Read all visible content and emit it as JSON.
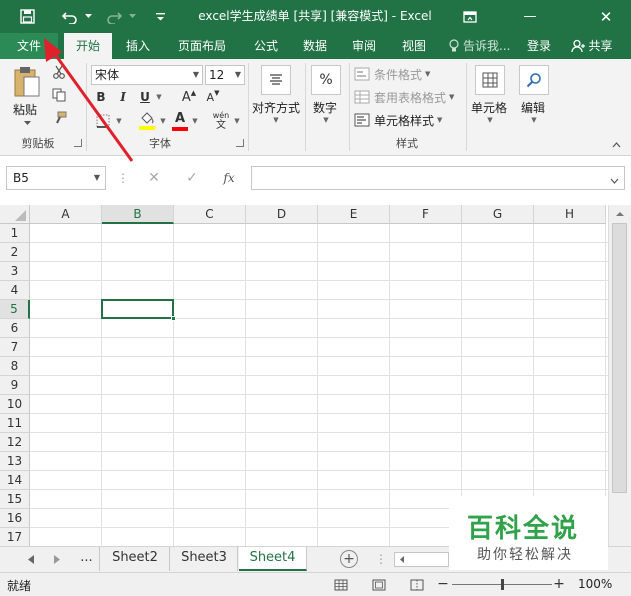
{
  "window": {
    "title": "excel学生成绩单  [共享]  [兼容模式] - Excel",
    "restore_icon": "ribbon-display-icon",
    "minimize_glyph": "—",
    "close_glyph": "✕"
  },
  "tabs": {
    "file": "文件",
    "items": [
      "开始",
      "插入",
      "页面布局",
      "公式",
      "数据",
      "审阅",
      "视图"
    ],
    "active": "开始",
    "tell_me": "告诉我...",
    "login": "登录",
    "share": "共享"
  },
  "ribbon": {
    "clipboard": {
      "paste": "粘贴",
      "label": "剪贴板"
    },
    "font": {
      "font_name": "宋体",
      "font_size": "12",
      "bold": "B",
      "italic": "I",
      "underline": "U",
      "grow": "A",
      "shrink": "A",
      "phonetic": "wén",
      "phonetic_sub": "文",
      "fill_color": "#ffff00",
      "font_color": "#ff0000",
      "label": "字体"
    },
    "alignment": {
      "label": "对齐方式"
    },
    "number": {
      "label": "数字",
      "symbol": "%"
    },
    "styles": {
      "conditional": "条件格式",
      "table": "套用表格格式",
      "cell_styles": "单元格样式",
      "label": "样式"
    },
    "cells": {
      "label": "单元格"
    },
    "editing": {
      "label": "编辑"
    }
  },
  "formula_bar": {
    "name_box": "B5",
    "cancel": "✕",
    "confirm": "✓",
    "fx": "fx",
    "value": ""
  },
  "grid": {
    "columns": [
      "A",
      "B",
      "C",
      "D",
      "E",
      "F",
      "G",
      "H"
    ],
    "rows": [
      "1",
      "2",
      "3",
      "4",
      "5",
      "6",
      "7",
      "8",
      "9",
      "10",
      "11",
      "12",
      "13",
      "14",
      "15",
      "16",
      "17"
    ],
    "selected_column": "B",
    "selected_row": "5"
  },
  "sheets": {
    "ellipsis": "...",
    "items": [
      "Sheet2",
      "Sheet3",
      "Sheet4"
    ],
    "active": "Sheet4",
    "add": "+"
  },
  "status": {
    "ready": "就绪",
    "zoom": "100%",
    "zoom_minus": "−",
    "zoom_plus": "+",
    "zoom_fraction": 0.5
  },
  "watermark": {
    "title": "百科全说",
    "subtitle": "助你轻松解决"
  },
  "colors": {
    "excel_green": "#217346",
    "annotation_red": "#e0202a",
    "watermark_green": "#2fa24a"
  }
}
